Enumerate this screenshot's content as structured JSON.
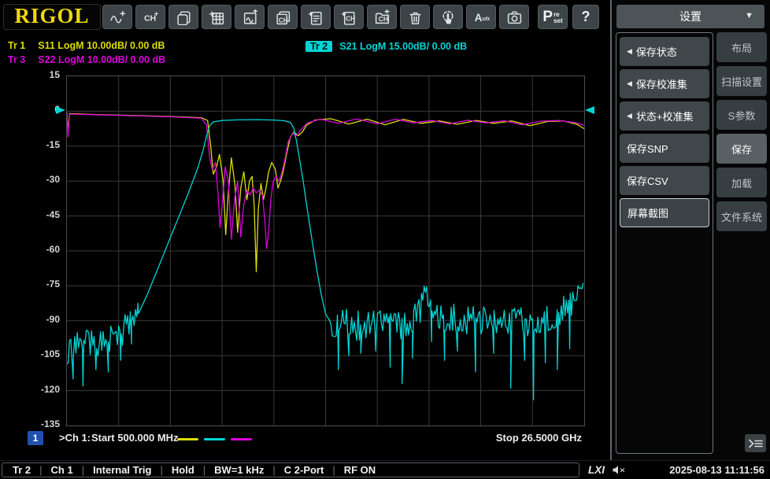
{
  "brand": "RIGOL",
  "toolbar": {
    "icons": [
      {
        "name": "new-trace"
      },
      {
        "name": "new-channel",
        "text": "CH",
        "sup": "+"
      },
      {
        "name": "duplicate-window"
      },
      {
        "name": "new-table"
      },
      {
        "name": "trace-window"
      },
      {
        "name": "channel-window",
        "text": "CH"
      },
      {
        "name": "file-task"
      },
      {
        "name": "file-channel",
        "text": "CH"
      },
      {
        "name": "folder-channel",
        "text": "CH"
      },
      {
        "name": "delete"
      },
      {
        "name": "touch"
      },
      {
        "name": "auto",
        "text": "A",
        "sub": "uto"
      },
      {
        "name": "screenshot"
      }
    ],
    "preset": {
      "big": "P",
      "line1": "re",
      "line2": "set"
    },
    "help_label": "?"
  },
  "legend": [
    {
      "id": "Tr 1",
      "text": "S11 LogM 10.00dB/ 0.00 dB",
      "color": "#dcdc00",
      "badge": false
    },
    {
      "id": "Tr 3",
      "text": "S22 LogM 10.00dB/ 0.00 dB",
      "color": "#dd00dd",
      "badge": false
    },
    {
      "id": "Tr 2",
      "text": "S21 LogM 15.00dB/ 0.00 dB",
      "color": "#00d4d4",
      "badge": true
    }
  ],
  "chart_data": {
    "type": "line",
    "y_axis": {
      "max": 15,
      "min": -135,
      "step": 15,
      "unit": "dB",
      "divisions": 10
    },
    "x_axis": {
      "divisions": 10,
      "start_label": "Start  500.000 MHz",
      "stop_label": "Stop  26.5000 GHz"
    },
    "footer": {
      "channel_badge": "1",
      "channel_label": ">Ch 1:"
    },
    "ref_marker_db": 0,
    "series": [
      {
        "name": "S11",
        "color": "#dcdc00",
        "segments": [
          {
            "type": "anchors",
            "points": [
              [
                0,
                -0.5
              ],
              [
                0.002,
                -9
              ],
              [
                0.005,
                -1
              ],
              [
                0.05,
                -1.4
              ],
              [
                0.12,
                -1.8
              ],
              [
                0.2,
                -2.3
              ],
              [
                0.26,
                -2.8
              ],
              [
                0.272,
                -4
              ],
              [
                0.278,
                -15
              ],
              [
                0.283,
                -27
              ],
              [
                0.289,
                -24
              ],
              [
                0.295,
                -18.5
              ],
              [
                0.302,
                -30
              ],
              [
                0.307,
                -53
              ],
              [
                0.312,
                -35
              ],
              [
                0.318,
                -20
              ],
              [
                0.325,
                -32
              ],
              [
                0.33,
                -52
              ],
              [
                0.336,
                -33
              ],
              [
                0.342,
                -26
              ],
              [
                0.348,
                -38
              ],
              [
                0.353,
                -30
              ],
              [
                0.358,
                -28
              ],
              [
                0.362,
                -40
              ],
              [
                0.366,
                -69
              ],
              [
                0.37,
                -42
              ],
              [
                0.375,
                -31
              ],
              [
                0.38,
                -38
              ],
              [
                0.385,
                -33
              ],
              [
                0.39,
                -26
              ],
              [
                0.396,
                -22
              ],
              [
                0.403,
                -25
              ],
              [
                0.408,
                -33
              ],
              [
                0.413,
                -30
              ],
              [
                0.418,
                -26
              ],
              [
                0.425,
                -18
              ],
              [
                0.432,
                -11
              ],
              [
                0.439,
                -9
              ],
              [
                0.447,
                -10.5
              ],
              [
                0.455,
                -9
              ],
              [
                0.463,
                -6
              ],
              [
                0.48,
                -3.8
              ],
              [
                0.51,
                -3.2
              ],
              [
                0.545,
                -5.5
              ],
              [
                0.58,
                -3.4
              ],
              [
                0.615,
                -5.8
              ],
              [
                0.65,
                -3.5
              ],
              [
                0.685,
                -5.2
              ],
              [
                0.72,
                -4.2
              ],
              [
                0.755,
                -5.6
              ],
              [
                0.79,
                -4
              ],
              [
                0.825,
                -5.2
              ],
              [
                0.86,
                -4.2
              ],
              [
                0.895,
                -6.2
              ],
              [
                0.93,
                -4.4
              ],
              [
                0.96,
                -4.2
              ],
              [
                0.985,
                -5.5
              ],
              [
                1,
                -7.5
              ]
            ]
          }
        ]
      },
      {
        "name": "S22",
        "color": "#dd00dd",
        "segments": [
          {
            "type": "anchors",
            "points": [
              [
                0,
                -0.5
              ],
              [
                0.002,
                -11
              ],
              [
                0.005,
                -1.2
              ],
              [
                0.05,
                -1.5
              ],
              [
                0.12,
                -1.9
              ],
              [
                0.2,
                -2.4
              ],
              [
                0.26,
                -3
              ],
              [
                0.27,
                -6
              ],
              [
                0.276,
                -20
              ],
              [
                0.281,
                -25
              ],
              [
                0.287,
                -22
              ],
              [
                0.292,
                -35
              ],
              [
                0.296,
                -50
              ],
              [
                0.301,
                -38
              ],
              [
                0.306,
                -24
              ],
              [
                0.312,
                -30
              ],
              [
                0.318,
                -55
              ],
              [
                0.324,
                -38
              ],
              [
                0.33,
                -30
              ],
              [
                0.336,
                -54
              ],
              [
                0.342,
                -40
              ],
              [
                0.348,
                -34
              ],
              [
                0.354,
                -36
              ],
              [
                0.36,
                -33
              ],
              [
                0.366,
                -35
              ],
              [
                0.372,
                -34
              ],
              [
                0.378,
                -36
              ],
              [
                0.383,
                -48
              ],
              [
                0.386,
                -59
              ],
              [
                0.39,
                -52
              ],
              [
                0.394,
                -38
              ],
              [
                0.399,
                -30
              ],
              [
                0.404,
                -28
              ],
              [
                0.41,
                -30
              ],
              [
                0.416,
                -26
              ],
              [
                0.422,
                -20
              ],
              [
                0.428,
                -13
              ],
              [
                0.436,
                -9.5
              ],
              [
                0.444,
                -10.5
              ],
              [
                0.452,
                -8
              ],
              [
                0.465,
                -5
              ],
              [
                0.49,
                -3.4
              ],
              [
                0.525,
                -5.2
              ],
              [
                0.56,
                -3.3
              ],
              [
                0.6,
                -5.4
              ],
              [
                0.635,
                -3.4
              ],
              [
                0.67,
                -5
              ],
              [
                0.705,
                -4
              ],
              [
                0.74,
                -5.4
              ],
              [
                0.775,
                -3.9
              ],
              [
                0.81,
                -5
              ],
              [
                0.845,
                -4.1
              ],
              [
                0.88,
                -5.8
              ],
              [
                0.915,
                -4.3
              ],
              [
                0.95,
                -4
              ],
              [
                0.98,
                -4.8
              ],
              [
                1,
                -6
              ]
            ]
          }
        ]
      },
      {
        "name": "S21",
        "color": "#00d4d4",
        "segments": [
          {
            "type": "noise",
            "x0": 0,
            "x1": 0.138,
            "jitter": 6.5,
            "base": [
              [
                0,
                -102
              ],
              [
                0.05,
                -100
              ],
              [
                0.09,
                -97
              ],
              [
                0.12,
                -92
              ],
              [
                0.138,
                -87
              ]
            ],
            "spikes": [
              [
                0.012,
                -115
              ],
              [
                0.031,
                -118
              ],
              [
                0.056,
                -111
              ],
              [
                0.08,
                -112
              ],
              [
                0.104,
                -107
              ],
              [
                0.125,
                -100
              ]
            ]
          },
          {
            "type": "anchors",
            "points": [
              [
                0.138,
                -87
              ],
              [
                0.155,
                -79
              ],
              [
                0.175,
                -68
              ],
              [
                0.195,
                -57
              ],
              [
                0.215,
                -46
              ],
              [
                0.235,
                -35
              ],
              [
                0.252,
                -25
              ],
              [
                0.263,
                -17
              ],
              [
                0.27,
                -10.5
              ],
              [
                0.276,
                -6.2
              ],
              [
                0.283,
                -4.6
              ],
              [
                0.3,
                -4
              ],
              [
                0.33,
                -3.7
              ],
              [
                0.37,
                -3.6
              ],
              [
                0.4,
                -3.8
              ],
              [
                0.42,
                -4.1
              ],
              [
                0.432,
                -4.8
              ],
              [
                0.438,
                -7
              ],
              [
                0.444,
                -13
              ],
              [
                0.45,
                -21
              ],
              [
                0.456,
                -29
              ],
              [
                0.462,
                -38
              ],
              [
                0.468,
                -47
              ],
              [
                0.475,
                -57
              ],
              [
                0.483,
                -68
              ],
              [
                0.492,
                -79
              ],
              [
                0.5,
                -87
              ],
              [
                0.508,
                -90
              ]
            ]
          },
          {
            "type": "noise",
            "x0": 0.508,
            "x1": 1,
            "jitter": 6.5,
            "base": [
              [
                0.508,
                -90
              ],
              [
                0.55,
                -92
              ],
              [
                0.6,
                -92
              ],
              [
                0.645,
                -93
              ],
              [
                0.675,
                -89
              ],
              [
                0.693,
                -80
              ],
              [
                0.703,
                -82
              ],
              [
                0.72,
                -87
              ],
              [
                0.76,
                -90
              ],
              [
                0.82,
                -90
              ],
              [
                0.87,
                -91
              ],
              [
                0.92,
                -89
              ],
              [
                0.96,
                -86
              ],
              [
                1,
                -79
              ]
            ],
            "spikes": [
              [
                0.525,
                -111
              ],
              [
                0.545,
                -105
              ],
              [
                0.568,
                -104
              ],
              [
                0.597,
                -103
              ],
              [
                0.625,
                -110
              ],
              [
                0.648,
                -117
              ],
              [
                0.668,
                -106
              ],
              [
                0.705,
                -99
              ],
              [
                0.73,
                -107
              ],
              [
                0.755,
                -103
              ],
              [
                0.79,
                -112
              ],
              [
                0.825,
                -104
              ],
              [
                0.858,
                -119
              ],
              [
                0.885,
                -107
              ],
              [
                0.902,
                -124
              ],
              [
                0.925,
                -108
              ],
              [
                0.948,
                -111
              ],
              [
                0.972,
                -102
              ]
            ]
          }
        ]
      }
    ]
  },
  "sidebar": {
    "header": {
      "label": "设置"
    },
    "submenu": [
      {
        "name": "save-state",
        "label": "保存状态",
        "arrow": true,
        "selected": false
      },
      {
        "name": "save-cal-set",
        "label": "保存校准集",
        "arrow": true,
        "selected": false
      },
      {
        "name": "state-cal-set",
        "label": "状态+校准集",
        "arrow": true,
        "selected": false
      },
      {
        "name": "save-snp",
        "label": "保存SNP",
        "arrow": false,
        "selected": false
      },
      {
        "name": "save-csv",
        "label": "保存CSV",
        "arrow": false,
        "selected": false
      },
      {
        "name": "screenshot",
        "label": "屏幕截图",
        "arrow": false,
        "selected": true
      }
    ],
    "tabs": [
      {
        "name": "layout",
        "label": "布局",
        "selected": false
      },
      {
        "name": "sweep-setup",
        "label": "扫描设置",
        "selected": false
      },
      {
        "name": "s-params",
        "label": "S参数",
        "selected": false
      },
      {
        "name": "save",
        "label": "保存",
        "selected": true
      },
      {
        "name": "load",
        "label": "加载",
        "selected": false
      },
      {
        "name": "file-system",
        "label": "文件系统",
        "selected": false
      }
    ]
  },
  "statusbar": {
    "items": [
      "Tr 2",
      "Ch 1",
      "Internal Trig",
      "Hold",
      "BW=1 kHz",
      "C 2-Port",
      "RF ON"
    ],
    "lxi_label": "LXI",
    "datetime": "2025-08-13 11:11:56"
  }
}
